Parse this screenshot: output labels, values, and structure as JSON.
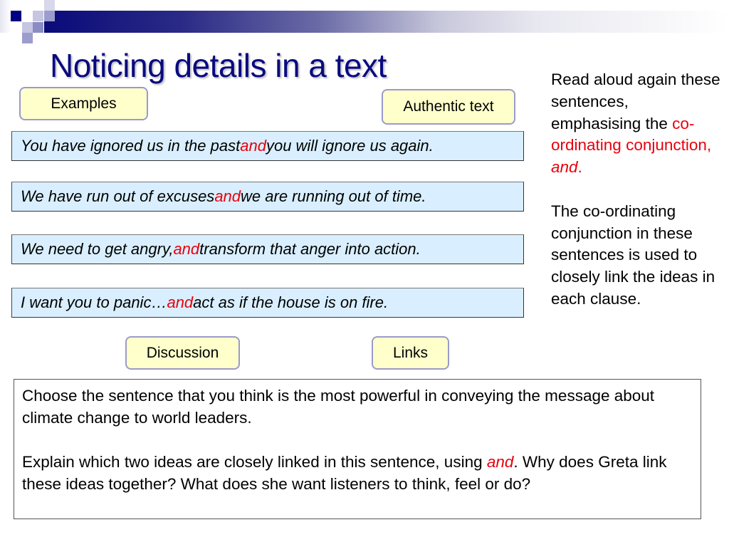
{
  "slide": {
    "title": "Noticing details in a text",
    "accent_color": "#0a0a80",
    "highlight_color": "#e8000c"
  },
  "buttons": {
    "examples": "Examples",
    "authentic_text": "Authentic text",
    "discussion": "Discussion",
    "links": "Links"
  },
  "sentences": [
    {
      "before": "You have ignored us in the past ",
      "conj": "and",
      "after": " you will ignore us again."
    },
    {
      "before": "We have run out of excuses ",
      "conj": "and",
      "after": " we are running out of time."
    },
    {
      "before": "We need to get angry, ",
      "conj": "and",
      "after": " transform that anger into action."
    },
    {
      "before": "I want you to panic…",
      "conj": "and",
      "after": " act as if the house is on fire."
    }
  ],
  "sidebar": {
    "instruction_black": "Read aloud again these sentences, emphasising the ",
    "instruction_red": "co-ordinating conjunction, ",
    "instruction_red_italic": "and",
    "instruction_red_end": ".",
    "explanation": "The co-ordinating conjunction in these sentences is used to closely link the ideas in each clause."
  },
  "task": {
    "paragraph1": "Choose the sentence that you think is the most powerful in conveying the message about climate change to world leaders.",
    "paragraph2_before": "Explain which two ideas are closely linked in this sentence, using ",
    "paragraph2_and": "and",
    "paragraph2_after": ". Why does Greta link these ideas together? What does she want listeners to think, feel or do?"
  }
}
